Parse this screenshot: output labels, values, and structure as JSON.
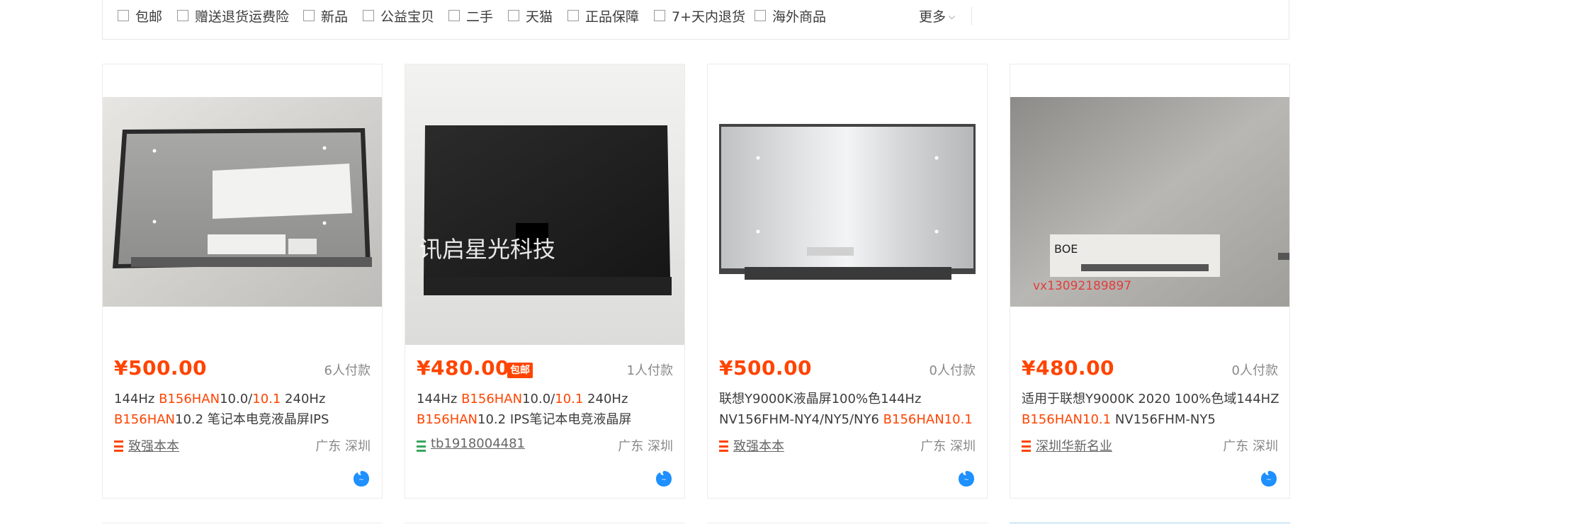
{
  "filters": [
    {
      "label": "包邮"
    },
    {
      "label": "赠送退货运费险"
    },
    {
      "label": "新品"
    },
    {
      "label": "公益宝贝"
    },
    {
      "label": "二手"
    },
    {
      "label": "天猫"
    },
    {
      "label": "正品保障"
    },
    {
      "label": "7+天内退货"
    },
    {
      "label": "海外商品"
    }
  ],
  "more_label": "更多",
  "colors": {
    "accent": "#ff4400",
    "shop_red": "#ff4400",
    "shop_green": "#3aa55c",
    "wangwang_blue": "#1e90ff"
  },
  "products": [
    {
      "price": "¥500.00",
      "badge": "",
      "sales": "6人付款",
      "title_segments": [
        {
          "t": "144Hz ",
          "hl": false
        },
        {
          "t": "B156HAN",
          "hl": true
        },
        {
          "t": "10.0/",
          "hl": false
        },
        {
          "t": "10.1",
          "hl": true
        },
        {
          "t": " 240Hz ",
          "hl": false
        },
        {
          "t": "B156HAN",
          "hl": true
        },
        {
          "t": "10.2 笔记本电竞液晶屏IPS",
          "hl": false
        }
      ],
      "shop": "致强本本",
      "shop_icon_color": "#ff4400",
      "location": "广东 深圳",
      "image_icon": "laptop-panel-photo"
    },
    {
      "price": "¥480.00",
      "badge": "包邮",
      "sales": "1人付款",
      "title_segments": [
        {
          "t": "144Hz ",
          "hl": false
        },
        {
          "t": "B156HAN",
          "hl": true
        },
        {
          "t": "10.0/",
          "hl": false
        },
        {
          "t": "10.1",
          "hl": true
        },
        {
          "t": " 240Hz ",
          "hl": false
        },
        {
          "t": "B156HAN",
          "hl": true
        },
        {
          "t": "10.2 IPS笔记本电竞液晶屏",
          "hl": false
        }
      ],
      "shop": "tb1918004481",
      "shop_icon_color": "#3aa55c",
      "location": "广东 深圳",
      "watermark": "讯启星光科技",
      "image_icon": "black-panel-photo"
    },
    {
      "price": "¥500.00",
      "badge": "",
      "sales": "0人付款",
      "title_segments": [
        {
          "t": "联想Y9000K液晶屏100%色144Hz NV156FHM-NY4/NY5/NY6 ",
          "hl": false
        },
        {
          "t": "B156HAN10.1",
          "hl": true
        }
      ],
      "shop": "致强本本",
      "shop_icon_color": "#ff4400",
      "location": "广东 深圳",
      "image_icon": "silver-panel-photo"
    },
    {
      "price": "¥480.00",
      "badge": "",
      "sales": "0人付款",
      "title_segments": [
        {
          "t": "适用于联想Y9000K 2020 100%色域144HZ ",
          "hl": false
        },
        {
          "t": "B156HAN10.1",
          "hl": true
        },
        {
          "t": " NV156FHM-NY5",
          "hl": false
        }
      ],
      "shop": "深圳华新名业",
      "shop_icon_color": "#ff4400",
      "location": "广东 深圳",
      "watermark": "vx13092189897",
      "label_text": "BOE",
      "image_icon": "panel-back-label-photo"
    }
  ]
}
